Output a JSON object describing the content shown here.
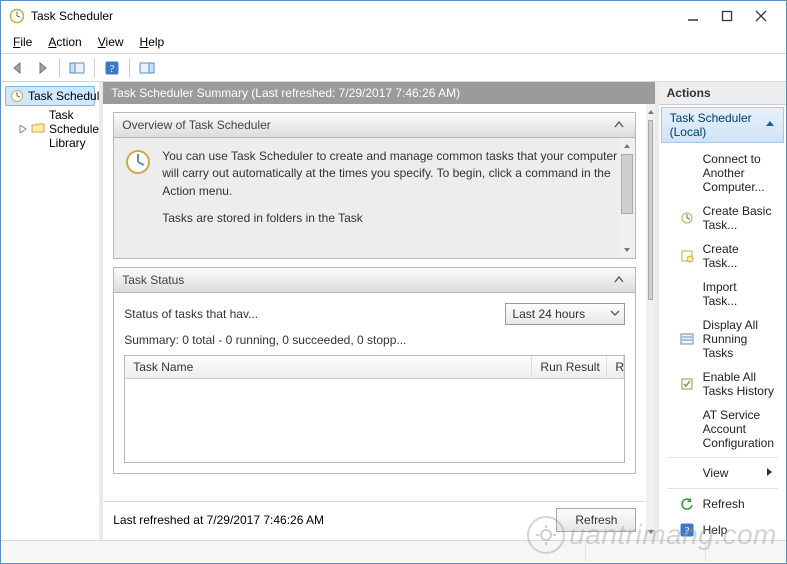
{
  "window": {
    "title": "Task Scheduler"
  },
  "menu": {
    "file": "File",
    "action": "Action",
    "view": "View",
    "help": "Help"
  },
  "tree": {
    "root": "Task Scheduler (Local)",
    "library": "Task Scheduler Library"
  },
  "summary": {
    "title": "Task Scheduler Summary (Last refreshed: 7/29/2017 7:46:26 AM)"
  },
  "overview": {
    "header": "Overview of Task Scheduler",
    "text": "You can use Task Scheduler to create and manage common tasks that your computer will carry out automatically at the times you specify. To begin, click a command in the Action menu.",
    "more": "Tasks are stored in folders in the Task"
  },
  "status": {
    "header": "Task Status",
    "label": "Status of tasks that hav...",
    "period": "Last 24 hours",
    "summary_line": "Summary: 0 total - 0 running, 0 succeeded, 0 stopp...",
    "columns": {
      "c1": "Task Name",
      "c2": "Run Result",
      "c3": "R"
    }
  },
  "footer": {
    "last_refreshed": "Last refreshed at 7/29/2017 7:46:26 AM",
    "refresh_btn": "Refresh"
  },
  "actions": {
    "title": "Actions",
    "scope": "Task Scheduler (Local)",
    "items": {
      "connect": "Connect to Another Computer...",
      "create_basic": "Create Basic Task...",
      "create_task": "Create Task...",
      "import": "Import Task...",
      "display_running": "Display All Running Tasks",
      "enable_history": "Enable All Tasks History",
      "at_config": "AT Service Account Configuration",
      "view": "View",
      "refresh": "Refresh",
      "help": "Help"
    }
  },
  "watermark": "uantrimang.com"
}
